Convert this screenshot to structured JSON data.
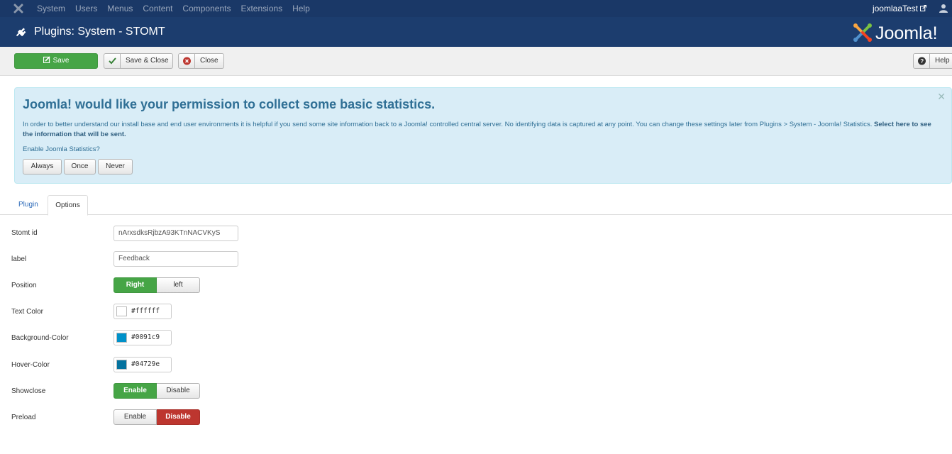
{
  "topbar": {
    "menu": [
      "System",
      "Users",
      "Menus",
      "Content",
      "Components",
      "Extensions",
      "Help"
    ],
    "user": "joomlaaTest"
  },
  "header": {
    "title": "Plugins: System - STOMT"
  },
  "toolbar": {
    "save": "Save",
    "save_close": "Save & Close",
    "close": "Close",
    "help": "Help"
  },
  "alert": {
    "heading": "Joomla! would like your permission to collect some basic statistics.",
    "body": "In order to better understand our install base and end user environments it is helpful if you send some site information back to a Joomla! controlled central server. No identifying data is captured at any point. You can change these settings later from Plugins > System - Joomla! Statistics.",
    "link": "Select here to see the information that will be sent.",
    "question": "Enable Joomla Statistics?",
    "options": [
      "Always",
      "Once",
      "Never"
    ]
  },
  "tabs": [
    "Plugin",
    "Options"
  ],
  "form": {
    "stomt_id_label": "Stomt id",
    "stomt_id_value": "nArxsdksRjbzA93KTnNACVKyS",
    "label_label": "label",
    "label_value": "Feedback",
    "position_label": "Position",
    "position_options": [
      "Right",
      "left"
    ],
    "position_selected": "Right",
    "text_color_label": "Text Color",
    "text_color": "#ffffff",
    "bg_color_label": "Background-Color",
    "bg_color": "#0091c9",
    "hover_color_label": "Hover-Color",
    "hover_color": "#04729e",
    "showclose_label": "Showclose",
    "showclose_options": [
      "Enable",
      "Disable"
    ],
    "showclose_selected": "Enable",
    "preload_label": "Preload",
    "preload_options": [
      "Enable",
      "Disable"
    ],
    "preload_selected": "Disable"
  }
}
